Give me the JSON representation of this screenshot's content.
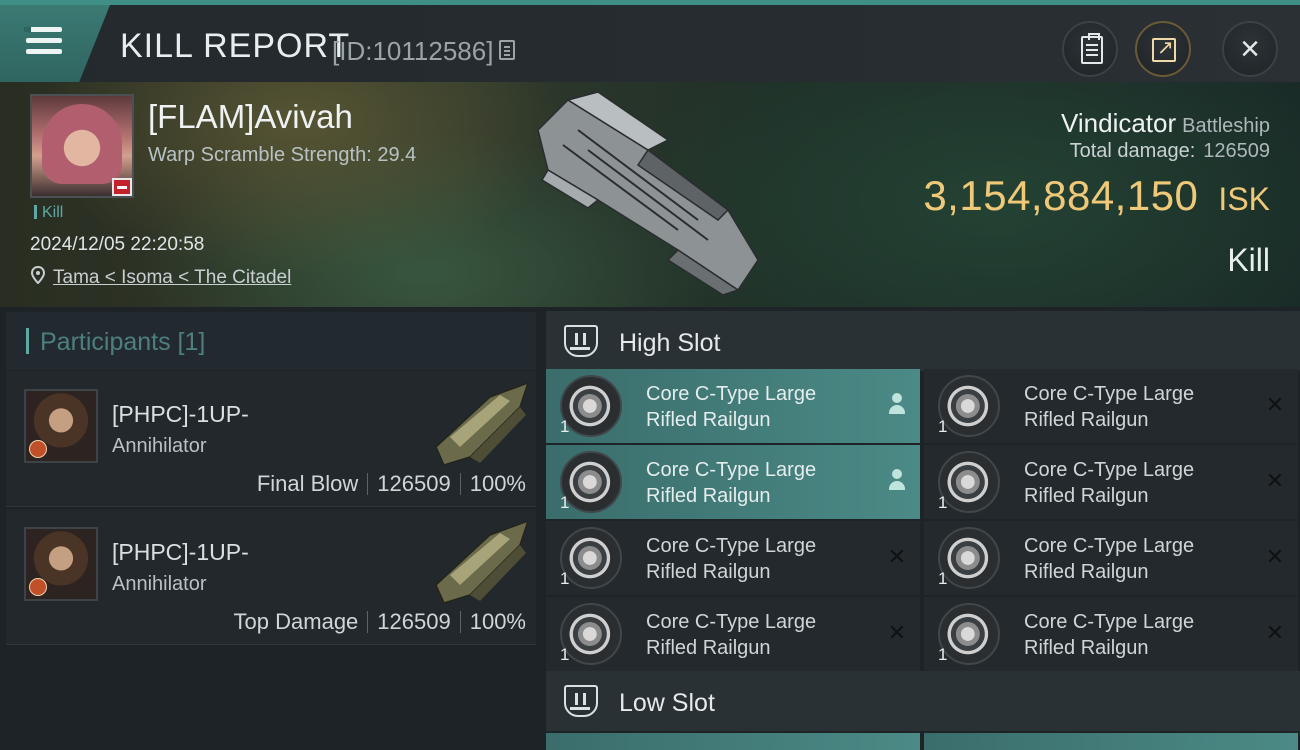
{
  "header": {
    "title": "KILL REPORT",
    "report_id": "[ID:10112586]"
  },
  "victim": {
    "name": "[FLAM]Avivah",
    "warp_scramble": "Warp Scramble Strength: 29.4",
    "tag": "Kill",
    "datetime": "2024/12/05 22:20:58",
    "location": "Tama < Isoma < The Citadel",
    "ship_name": "Vindicator",
    "ship_class": "Battleship",
    "total_damage_label": "Total damage:",
    "total_damage": "126509",
    "isk_value": "3,154,884,150",
    "isk_unit": "ISK",
    "result": "Kill"
  },
  "participants": {
    "title": "Participants [1]",
    "rows": [
      {
        "name": "[PHPC]-1UP-",
        "ship": "Annihilator",
        "role": "Final Blow",
        "damage": "126509",
        "percent": "100%"
      },
      {
        "name": "[PHPC]-1UP-",
        "ship": "Annihilator",
        "role": "Top Damage",
        "damage": "126509",
        "percent": "100%"
      }
    ]
  },
  "slots": {
    "high": {
      "title": "High Slot",
      "modules": [
        {
          "line1": "Core C-Type Large",
          "line2": "Rifled Railgun",
          "qty": "1",
          "state": "dropped"
        },
        {
          "line1": "Core C-Type Large",
          "line2": "Rifled Railgun",
          "qty": "1",
          "state": "destroyed"
        },
        {
          "line1": "Core C-Type Large",
          "line2": "Rifled Railgun",
          "qty": "1",
          "state": "dropped"
        },
        {
          "line1": "Core C-Type Large",
          "line2": "Rifled Railgun",
          "qty": "1",
          "state": "destroyed"
        },
        {
          "line1": "Core C-Type Large",
          "line2": "Rifled Railgun",
          "qty": "1",
          "state": "destroyed"
        },
        {
          "line1": "Core C-Type Large",
          "line2": "Rifled Railgun",
          "qty": "1",
          "state": "destroyed"
        },
        {
          "line1": "Core C-Type Large",
          "line2": "Rifled Railgun",
          "qty": "1",
          "state": "destroyed"
        },
        {
          "line1": "Core C-Type Large",
          "line2": "Rifled Railgun",
          "qty": "1",
          "state": "destroyed"
        }
      ]
    },
    "low": {
      "title": "Low Slot"
    }
  },
  "icons": {
    "menu": "hamburger-icon",
    "copy": "copy-icon",
    "clipboard": "clipboard-icon",
    "share": "share-icon",
    "close": "close-icon",
    "location": "location-pin-icon",
    "slot": "slot-icon",
    "dropped": "person-icon",
    "destroyed": "x-icon"
  },
  "colors": {
    "accent": "#5fa9a4",
    "isk": "#f0c978",
    "dropped_bg": "#4b8a86"
  }
}
